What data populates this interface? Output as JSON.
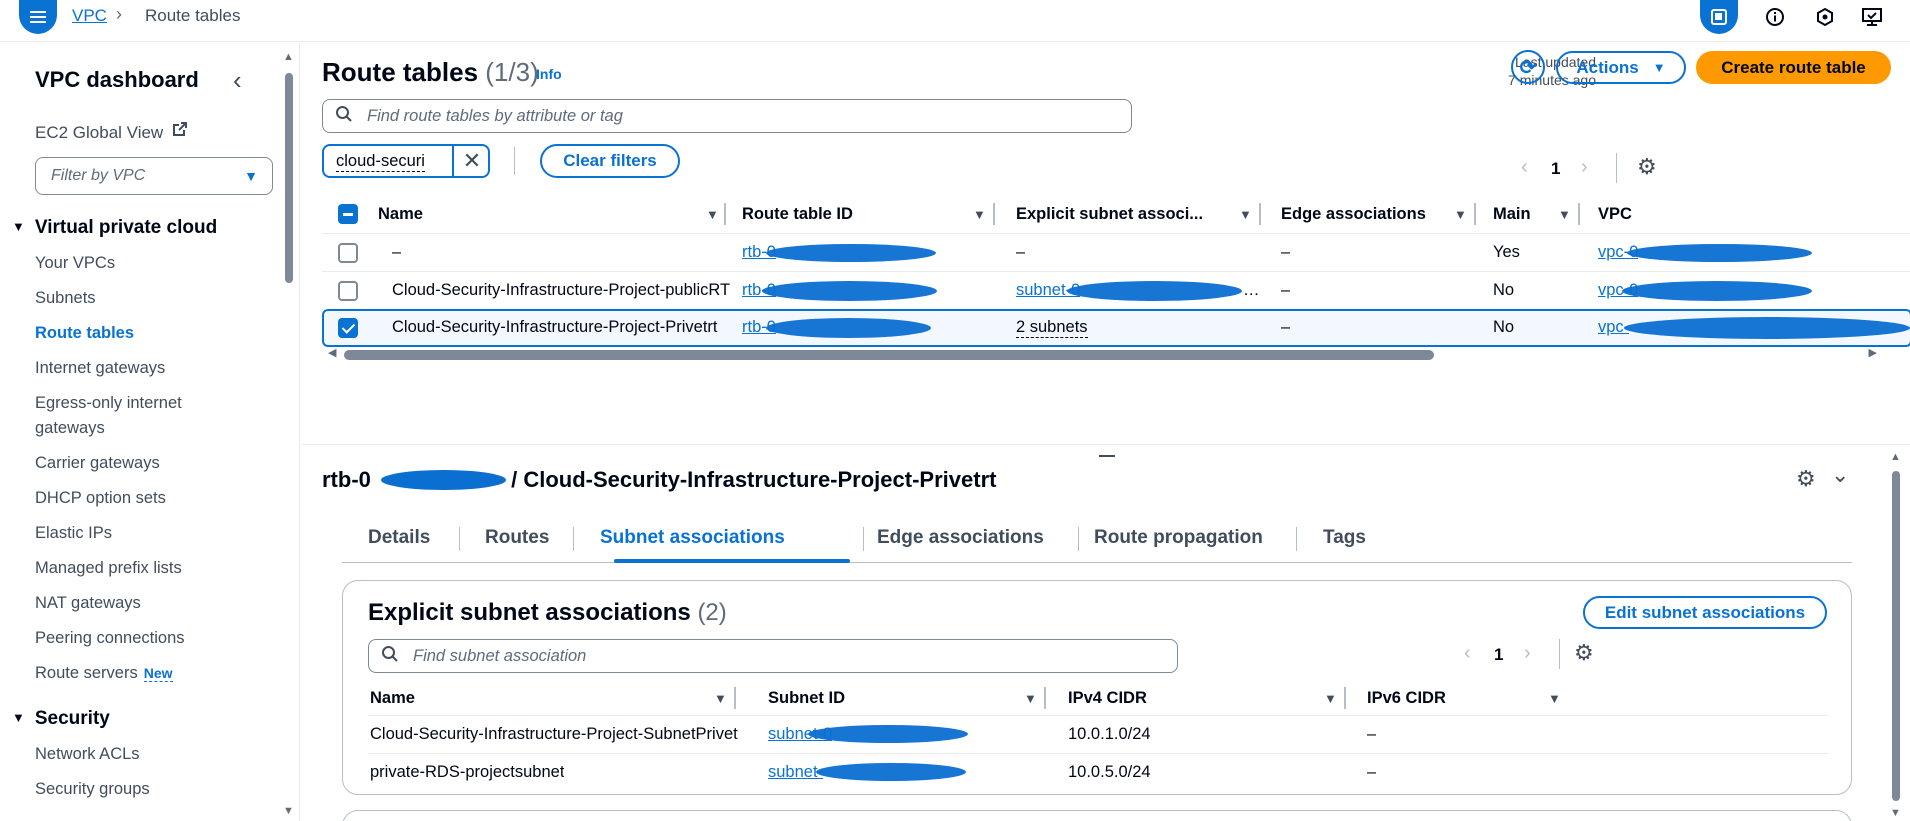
{
  "header": {
    "breadcrumb_root": "VPC",
    "breadcrumb_current": "Route tables"
  },
  "sidebar": {
    "title": "VPC dashboard",
    "ec2_global_view": "EC2 Global View",
    "filter_placeholder": "Filter by VPC",
    "group_vpc": "Virtual private cloud",
    "vpc_items": [
      "Your VPCs",
      "Subnets",
      "Route tables",
      "Internet gateways",
      "Egress-only internet gateways",
      "Carrier gateways",
      "DHCP option sets",
      "Elastic IPs",
      "Managed prefix lists",
      "NAT gateways",
      "Peering connections",
      "Route servers"
    ],
    "new_badge": "New",
    "group_security": "Security",
    "security_items": [
      "Network ACLs",
      "Security groups"
    ]
  },
  "route_tables": {
    "title": "Route tables",
    "count": "(1/3)",
    "info": "Info",
    "last_updated_label": "Last updated",
    "last_updated_value": "7 minutes ago",
    "actions_label": "Actions",
    "create_label": "Create route table",
    "search_placeholder": "Find route tables by attribute or tag",
    "filter_token": "cloud-securi",
    "clear_filters": "Clear filters",
    "page": "1",
    "columns": [
      "Name",
      "Route table ID",
      "Explicit subnet associ...",
      "Edge associations",
      "Main",
      "VPC"
    ],
    "rows": [
      {
        "name": "–",
        "id": "rtb-0",
        "explicit": "–",
        "edge": "–",
        "main": "Yes",
        "vpc": "vpc-0",
        "selected": false
      },
      {
        "name": "Cloud-Security-Infrastructure-Project-publicRT",
        "id": "rtb-0",
        "explicit": "subnet-0",
        "edge": "–",
        "main": "No",
        "vpc": "vpc-0",
        "selected": false
      },
      {
        "name": "Cloud-Security-Infrastructure-Project-Privetrt",
        "id": "rtb-0",
        "explicit": "2 subnets",
        "edge": "–",
        "main": "No",
        "vpc": "vpc-",
        "selected": true
      }
    ]
  },
  "details": {
    "title_prefix": "rtb-0",
    "title_suffix": "/ Cloud-Security-Infrastructure-Project-Privetrt",
    "tabs": [
      "Details",
      "Routes",
      "Subnet associations",
      "Edge associations",
      "Route propagation",
      "Tags"
    ],
    "active_tab": "Subnet associations",
    "card_title": "Explicit subnet associations",
    "card_count": "(2)",
    "edit_label": "Edit subnet associations",
    "search_placeholder": "Find subnet association",
    "page": "1",
    "columns": [
      "Name",
      "Subnet ID",
      "IPv4 CIDR",
      "IPv6 CIDR"
    ],
    "rows": [
      {
        "name": "Cloud-Security-Infrastructure-Project-SubnetPrivet",
        "subnet": "subnet-0",
        "ipv4": "10.0.1.0/24",
        "ipv6": "–"
      },
      {
        "name": "private-RDS-projectsubnet",
        "subnet": "subnet-",
        "ipv4": "10.0.5.0/24",
        "ipv6": "–"
      }
    ]
  },
  "colors": {
    "accent": "#0972d3",
    "primary_button": "#ff9900",
    "redaction": "#0b6ed1"
  }
}
